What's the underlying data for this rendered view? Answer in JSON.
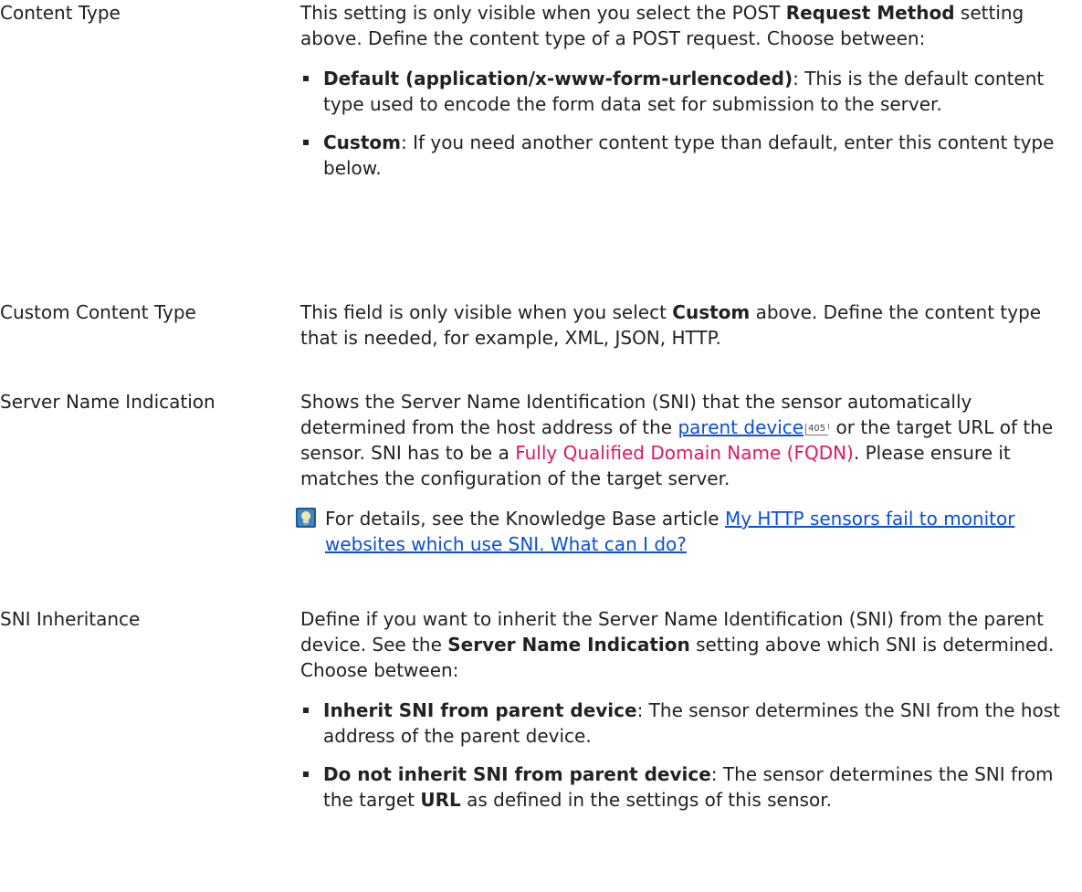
{
  "rows": [
    {
      "label": "Content Type",
      "intro": {
        "a": "This setting is only visible when you select the POST ",
        "b": "Request Method",
        "c": " setting above. Define the content type of a POST request. Choose between:"
      },
      "bullets": [
        {
          "term": "Default (application/x-www-form-urlencoded)",
          "text": ": This is the default content type used to encode the form data set for submission to the server."
        },
        {
          "term": "Custom",
          "text": ": If you need another content type than default, enter this content type below."
        }
      ]
    },
    {
      "label": "Custom Content Type",
      "intro": {
        "a": "This field is only visible when you select ",
        "b": "Custom",
        "c": " above. Define the content type that is needed, for example, XML, JSON, HTTP."
      }
    },
    {
      "label": "Server Name Indication",
      "text_a": "Shows the Server Name Identification (SNI) that the sensor automatically determined from the host address of the ",
      "link": "parent device",
      "page_ref": "405",
      "text_b": " or the target URL of the sensor. SNI has to be a ",
      "pink": "Fully Qualified Domain Name (FQDN)",
      "text_c": ". Please ensure it matches the configuration of the target server.",
      "kb": {
        "icon": "knowledge-base-icon",
        "text": "For details, see the Knowledge Base article ",
        "link": "My HTTP sensors fail to monitor websites which use SNI. What can I do?"
      }
    },
    {
      "label": "SNI Inheritance",
      "intro": {
        "a": "Define if you want to inherit the Server Name Identification (SNI) from the parent device. See the ",
        "b": "Server Name Indication",
        "c": " setting above which SNI is determined. Choose between:"
      },
      "bullets": [
        {
          "term": "Inherit SNI from parent device",
          "text": ": The sensor determines the SNI from the host address of the parent device."
        },
        {
          "term_a": "Do not inherit SNI from parent device",
          "text_a": ": The sensor determines the SNI from the target ",
          "term_b": "URL",
          "text_b": " as defined in the settings of this sensor."
        }
      ]
    }
  ],
  "colors": {
    "text": "#222222",
    "link": "#0b4fd6",
    "highlight": "#e0185f"
  }
}
